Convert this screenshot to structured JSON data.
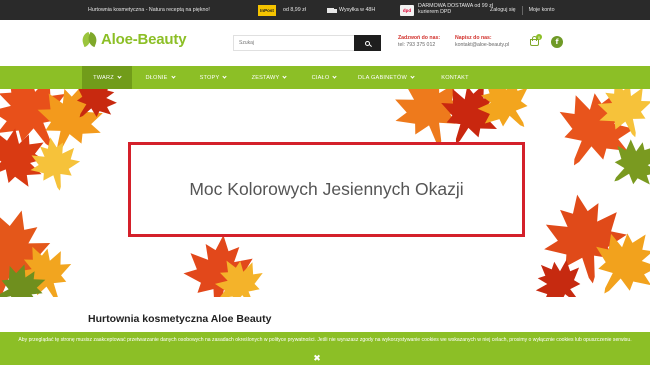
{
  "topbar": {
    "tagline": "Hurtownia kosmetyczna - Natura receptą na piękno!",
    "inpost_logo": "InPost",
    "inpost_price": "od 8,99 zł",
    "shipping_time": "Wysyłka w 48H",
    "dpd_logo": "dpd",
    "dpd_text": "DARMOWA DOSTAWA od 99 zł kurierem DPD",
    "login": "Zaloguj się",
    "account": "Moje konto"
  },
  "header": {
    "logo_part1": "Aloe-",
    "logo_part2": "Beauty",
    "search_placeholder": "Szukaj",
    "phone_label": "Zadzwoń do nas:",
    "phone_value": "tel: 793 375 012",
    "email_label": "Napisz do nas:",
    "email_value": "kontakt@aloe-beauty.pl",
    "cart_count": "0",
    "facebook_glyph": "f"
  },
  "nav": {
    "items": [
      {
        "label": "TWARZ",
        "active": true,
        "dropdown": true
      },
      {
        "label": "DŁONIE",
        "active": false,
        "dropdown": true
      },
      {
        "label": "STOPY",
        "active": false,
        "dropdown": true
      },
      {
        "label": "ZESTAWY",
        "active": false,
        "dropdown": true
      },
      {
        "label": "CIAŁO",
        "active": false,
        "dropdown": true
      },
      {
        "label": "DLA GABINETÓW",
        "active": false,
        "dropdown": true
      },
      {
        "label": "KONTAKT",
        "active": false,
        "dropdown": false
      }
    ]
  },
  "banner": {
    "text": "Moc Kolorowych Jesiennych Okazji"
  },
  "page": {
    "title": "Hurtownia kosmetyczna Aloe Beauty"
  },
  "cookie": {
    "text": "Aby przeglądać tę stronę musisz zaakceptować przetwarzanie danych osobowych na zasadach określonych w polityce prywatności. Jeśli nie wyrazasz zgody na wykorzystywanie cookies we wskazanych w niej celach, prosimy o wyłącznie cookies lub opuszczenie serwisu.",
    "close_glyph": "✖"
  },
  "colors": {
    "brand_green": "#8cbf26",
    "nav_active": "#719c1a",
    "accent_red": "#d4202a",
    "topbar_bg": "#2a2a2a"
  }
}
